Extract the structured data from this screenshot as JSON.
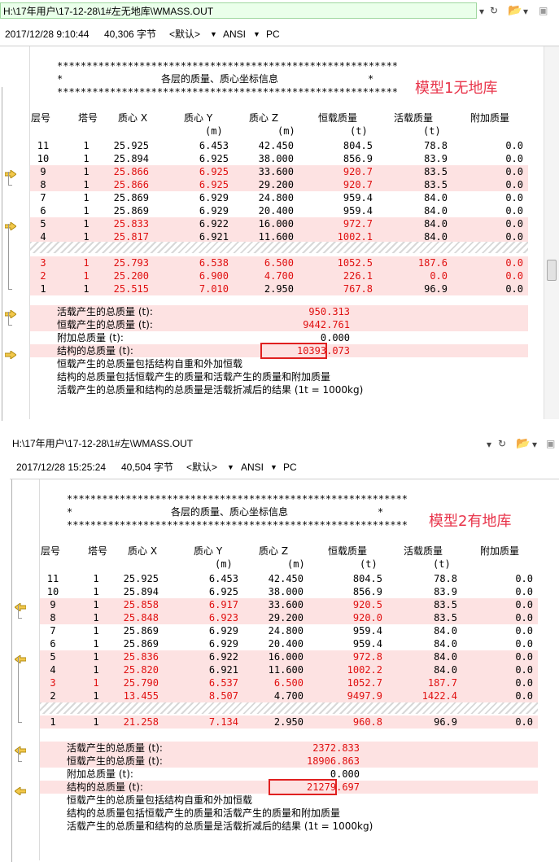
{
  "columns": [
    "层号",
    "塔号",
    "质心 X",
    "质心 Y",
    "质心 Z",
    "恒载质量",
    "活载质量",
    "附加质量"
  ],
  "units": [
    "(m)",
    "(m)",
    "(t)",
    "(t)"
  ],
  "stars": "**********************************************************",
  "star": "*",
  "section_title": "各层的质量、质心坐标信息",
  "panels": [
    {
      "path": "H:\\17年用户\\17-12-28\\1#左无地库\\WMASS.OUT",
      "date": "2017/12/28 9:10:44",
      "size": "40,306 字节",
      "encoding_default": "<默认>",
      "encoding": "ANSI",
      "line_end": "PC",
      "annotation": "模型1无地库",
      "rows": [
        [
          "11",
          "1",
          "25.925",
          "6.453",
          "42.450",
          "804.5",
          "78.8",
          "0.0"
        ],
        [
          "10",
          "1",
          "25.894",
          "6.925",
          "38.000",
          "856.9",
          "83.9",
          "0.0"
        ],
        [
          "9",
          "1",
          "25.866",
          "6.925",
          "33.600",
          "920.7",
          "83.5",
          "0.0"
        ],
        [
          "8",
          "1",
          "25.866",
          "6.925",
          "29.200",
          "920.7",
          "83.5",
          "0.0"
        ],
        [
          "7",
          "1",
          "25.869",
          "6.929",
          "24.800",
          "959.4",
          "84.0",
          "0.0"
        ],
        [
          "6",
          "1",
          "25.869",
          "6.929",
          "20.400",
          "959.4",
          "84.0",
          "0.0"
        ],
        [
          "5",
          "1",
          "25.833",
          "6.922",
          "16.000",
          "972.7",
          "84.0",
          "0.0"
        ],
        [
          "4",
          "1",
          "25.817",
          "6.921",
          "11.600",
          "1002.1",
          "84.0",
          "0.0"
        ],
        [
          "3",
          "1",
          "25.793",
          "6.538",
          "6.500",
          "1052.5",
          "187.6",
          "0.0"
        ],
        [
          "2",
          "1",
          "25.200",
          "6.900",
          "4.700",
          "226.1",
          "0.0",
          "0.0"
        ],
        [
          "1",
          "1",
          "25.515",
          "7.010",
          "2.950",
          "767.8",
          "96.9",
          "0.0"
        ]
      ],
      "summary": {
        "live_label": "活载产生的总质量 (t):",
        "live": "950.313",
        "dead_label": "恒载产生的总质量 (t):",
        "dead": "9442.761",
        "add_label": "附加总质量 (t):",
        "add": "0.000",
        "total_label": "结构的总质量 (t):",
        "total": "10393.073"
      }
    },
    {
      "path": "H:\\17年用户\\17-12-28\\1#左\\WMASS.OUT",
      "date": "2017/12/28 15:25:24",
      "size": "40,504 字节",
      "encoding_default": "<默认>",
      "encoding": "ANSI",
      "line_end": "PC",
      "annotation": "模型2有地库",
      "rows": [
        [
          "11",
          "1",
          "25.925",
          "6.453",
          "42.450",
          "804.5",
          "78.8",
          "0.0"
        ],
        [
          "10",
          "1",
          "25.894",
          "6.925",
          "38.000",
          "856.9",
          "83.9",
          "0.0"
        ],
        [
          "9",
          "1",
          "25.858",
          "6.917",
          "33.600",
          "920.5",
          "83.5",
          "0.0"
        ],
        [
          "8",
          "1",
          "25.848",
          "6.923",
          "29.200",
          "920.0",
          "83.5",
          "0.0"
        ],
        [
          "7",
          "1",
          "25.869",
          "6.929",
          "24.800",
          "959.4",
          "84.0",
          "0.0"
        ],
        [
          "6",
          "1",
          "25.869",
          "6.929",
          "20.400",
          "959.4",
          "84.0",
          "0.0"
        ],
        [
          "5",
          "1",
          "25.836",
          "6.922",
          "16.000",
          "972.8",
          "84.0",
          "0.0"
        ],
        [
          "4",
          "1",
          "25.820",
          "6.921",
          "11.600",
          "1002.2",
          "84.0",
          "0.0"
        ],
        [
          "3",
          "1",
          "25.790",
          "6.537",
          "6.500",
          "1052.7",
          "187.7",
          "0.0"
        ],
        [
          "2",
          "1",
          "13.455",
          "8.507",
          "4.700",
          "9497.9",
          "1422.4",
          "0.0"
        ],
        [
          "1",
          "1",
          "21.258",
          "7.134",
          "2.950",
          "960.8",
          "96.9",
          "0.0"
        ]
      ],
      "summary": {
        "live_label": "活载产生的总质量 (t):",
        "live": "2372.833",
        "dead_label": "恒载产生的总质量 (t):",
        "dead": "18906.863",
        "add_label": "附加总质量 (t):",
        "add": "0.000",
        "total_label": "结构的总质量 (t):",
        "total": "21279.697"
      }
    }
  ],
  "notes": [
    "恒载产生的总质量包括结构自重和外加恒载",
    "结构的总质量包括恒载产生的质量和活载产生的质量和附加质量",
    "活载产生的总质量和结构的总质量是活载折减后的结果 (1t = 1000kg)"
  ]
}
